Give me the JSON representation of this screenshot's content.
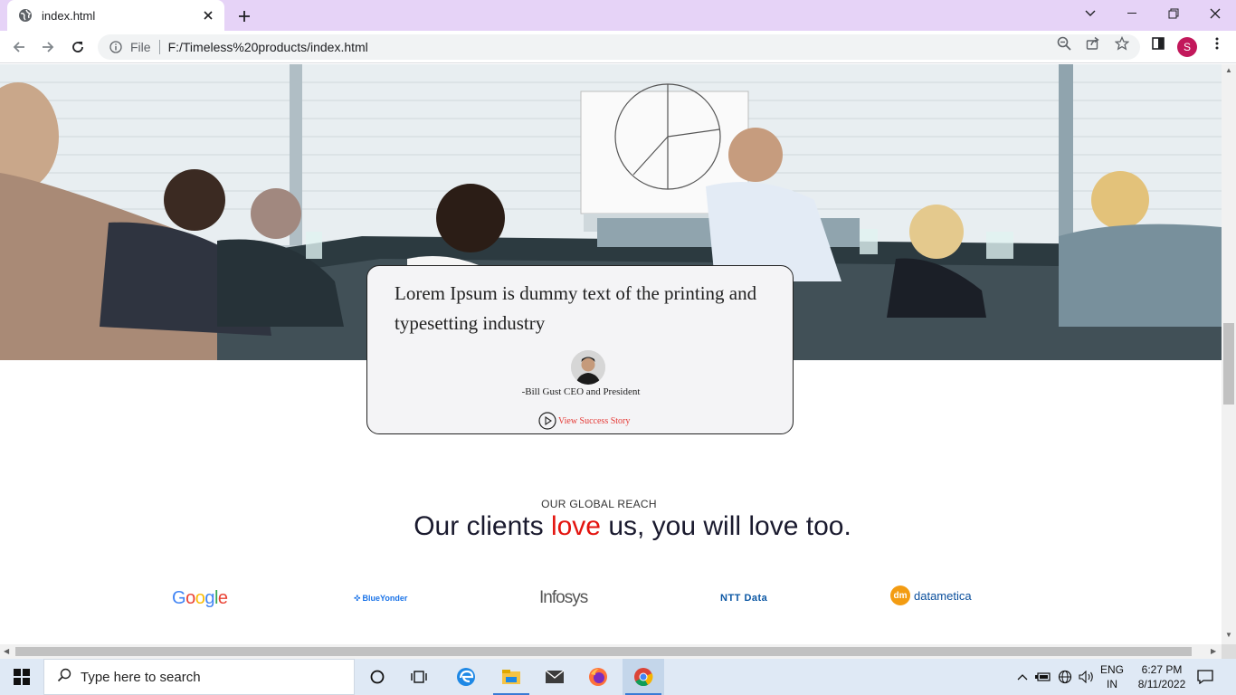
{
  "browser": {
    "tab_title": "index.html",
    "omnibox_scheme_label": "File",
    "url": "F:/Timeless%20products/index.html",
    "profile_initial": "S"
  },
  "testimonial": {
    "quote": "Lorem Ipsum is dummy text of the printing and typesetting industry",
    "author": "-Bill Gust CEO and President",
    "story_link": "View Success Story"
  },
  "clients": {
    "eyebrow": "OUR GLOBAL REACH",
    "title_before": "Our clients ",
    "title_accent": "love",
    "title_after": " us, you will love too.",
    "logos": {
      "google": "Google",
      "blueyonder": "BlueYonder",
      "infosys": "Infosys",
      "ntt": "NTT Data",
      "datametica_badge": "dm",
      "datametica": "datametica"
    }
  },
  "taskbar": {
    "search_placeholder": "Type here to search",
    "lang_line1": "ENG",
    "lang_line2": "IN",
    "time": "6:27 PM",
    "date": "8/11/2022"
  },
  "colors": {
    "tab_strip": "#e6d3f7",
    "accent_red": "#e3140f",
    "profile_avatar": "#c2185b"
  }
}
